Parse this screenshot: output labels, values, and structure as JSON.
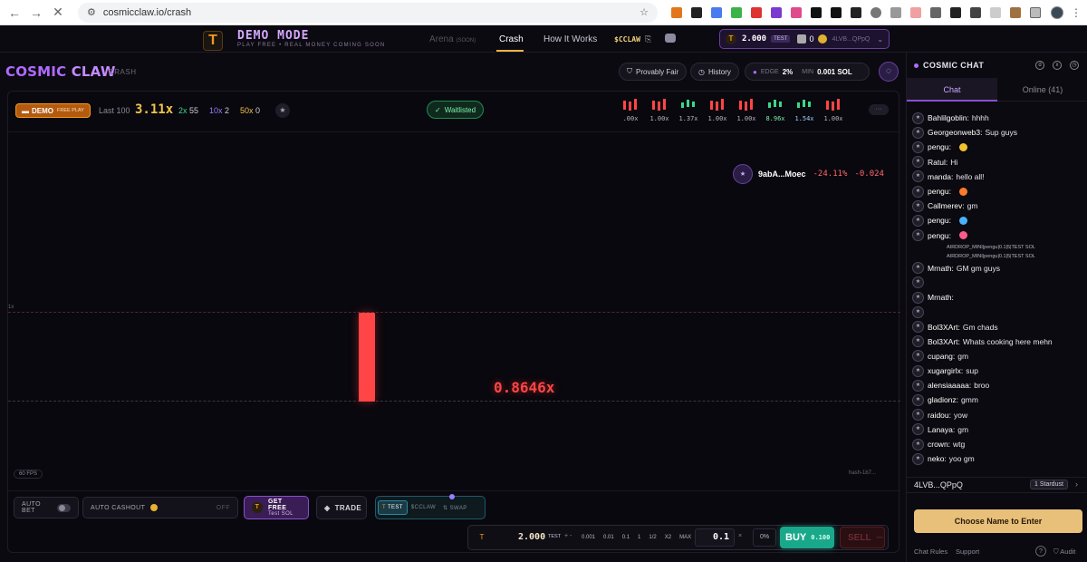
{
  "browser": {
    "url": "cosmicclaw.io/crash"
  },
  "topnav": {
    "demo_title": "DEMO MODE",
    "demo_sub": "PLAY FREE • REAL MONEY COMING SOON",
    "arena": "Arena",
    "arena_soon": "(SOON)",
    "crash": "Crash",
    "how": "How It Works",
    "cclaw": "$CCLAW",
    "wallet": {
      "balance": "2.000",
      "tag": "TEST",
      "count": "0",
      "addr": "4LVB...QPpQ"
    }
  },
  "gamebar": {
    "brand_a": "COSMIC",
    "brand_b": "CLAW",
    "brand_sub": "CRASH",
    "provably_fair": "Provably Fair",
    "history": "History",
    "edge_label": "EDGE",
    "edge_value": "2%",
    "min_label": "MIN",
    "min_value": "0.001 SOL"
  },
  "stats": {
    "demo": "DEMO",
    "free_play": "FREE PLAY",
    "last100_label": "Last 100",
    "last100_value": "3.11x",
    "c2_label": "2x",
    "c2_value": "55",
    "c10_label": "10x",
    "c10_value": "2",
    "c50_label": "50x",
    "c50_value": "0",
    "waitlisted": "Waitlisted",
    "history": [
      {
        "label": ".00x",
        "color": "#ff4545"
      },
      {
        "label": "1.00x",
        "color": "#ff4545"
      },
      {
        "label": "1.37x",
        "color": "#39d98a"
      },
      {
        "label": "1.00x",
        "color": "#ff4545"
      },
      {
        "label": "1.00x",
        "color": "#ff4545"
      },
      {
        "label": "8.96x",
        "color": "#39d98a"
      },
      {
        "label": "1.54x",
        "color": "#39d98a"
      },
      {
        "label": "1.00x",
        "color": "#ff4545"
      }
    ],
    "more": "···"
  },
  "chart": {
    "live_player": "9abA...Moec",
    "live_pct": "-24.11%",
    "live_sol": "-0.024",
    "onex": "1x",
    "multiplier": "0.8646x",
    "fps": "60 FPS",
    "hash": "hash-1b7..."
  },
  "controls": {
    "auto_bet": "AUTO BET",
    "auto_cashout": "AUTO CASHOUT",
    "off": "OFF",
    "get_free": "GET FREE",
    "get_free_sub": "Test SOL",
    "trade": "TRADE",
    "seg_test": "TEST",
    "seg_cclaw": "$CCLAW",
    "seg_swap": "SWAP",
    "bet_amount": "2.000",
    "bet_tag": "TEST",
    "pm": "+ -",
    "quick": [
      "0.001",
      "0.01",
      "0.1",
      "1",
      "1/2",
      "X2",
      "MAX"
    ],
    "input_value": "0.1",
    "x": "×",
    "pct": "0%",
    "buy": "BUY",
    "buy_amt": "0.100",
    "sell": "SELL"
  },
  "chat": {
    "title": "COSMIC CHAT",
    "tab_chat": "Chat",
    "tab_online": "Online (41)",
    "messages": [
      {
        "name": "Bahlilgoblin:",
        "text": "hhhh"
      },
      {
        "name": "Georgeonweb3:",
        "text": "Sup guys"
      },
      {
        "name": "pengu:",
        "text": "",
        "emoji": "#f2c230"
      },
      {
        "name": "Ratul:",
        "text": "Hi"
      },
      {
        "name": "manda:",
        "text": "hello all!"
      },
      {
        "name": "pengu:",
        "text": "",
        "emoji": "#ff7a2a"
      },
      {
        "name": "Callmerev:",
        "text": "gm"
      },
      {
        "name": "pengu:",
        "text": "",
        "emoji": "#4ab0ff"
      },
      {
        "name": "pengu:",
        "text": "",
        "emoji": "#ff5a8a"
      }
    ],
    "sys1": "AIRDROP_MINI|pengu|0.1|5|TEST SOL",
    "sys2": "AIRDROP_MINI|pengu|0.1|5|TEST SOL",
    "messages2": [
      {
        "name": "Mrnath:",
        "text": "GM gm guys"
      },
      {
        "name": "",
        "text": ""
      },
      {
        "name": "Mrnath:",
        "text": ""
      },
      {
        "name": "",
        "text": ""
      },
      {
        "name": "Bol3XArt:",
        "text": "Gm chads"
      },
      {
        "name": "Bol3XArt:",
        "text": "Whats cooking here mehn"
      },
      {
        "name": "cupang:",
        "text": "gm"
      },
      {
        "name": "xugargirlx:",
        "text": "sup"
      },
      {
        "name": "alensiaaaaa:",
        "text": "broo"
      },
      {
        "name": "gladionz:",
        "text": "gmm"
      },
      {
        "name": "raidou:",
        "text": "yow"
      },
      {
        "name": "Lanaya:",
        "text": "gm"
      },
      {
        "name": "crown:",
        "text": "wtg"
      },
      {
        "name": "neko:",
        "text": "yoo gm"
      }
    ],
    "user_addr": "4LVB...QPpQ",
    "stardust": "1 Stardust",
    "enter": "Choose Name to Enter",
    "rules": "Chat Rules",
    "support": "Support",
    "audit": "Audit"
  }
}
